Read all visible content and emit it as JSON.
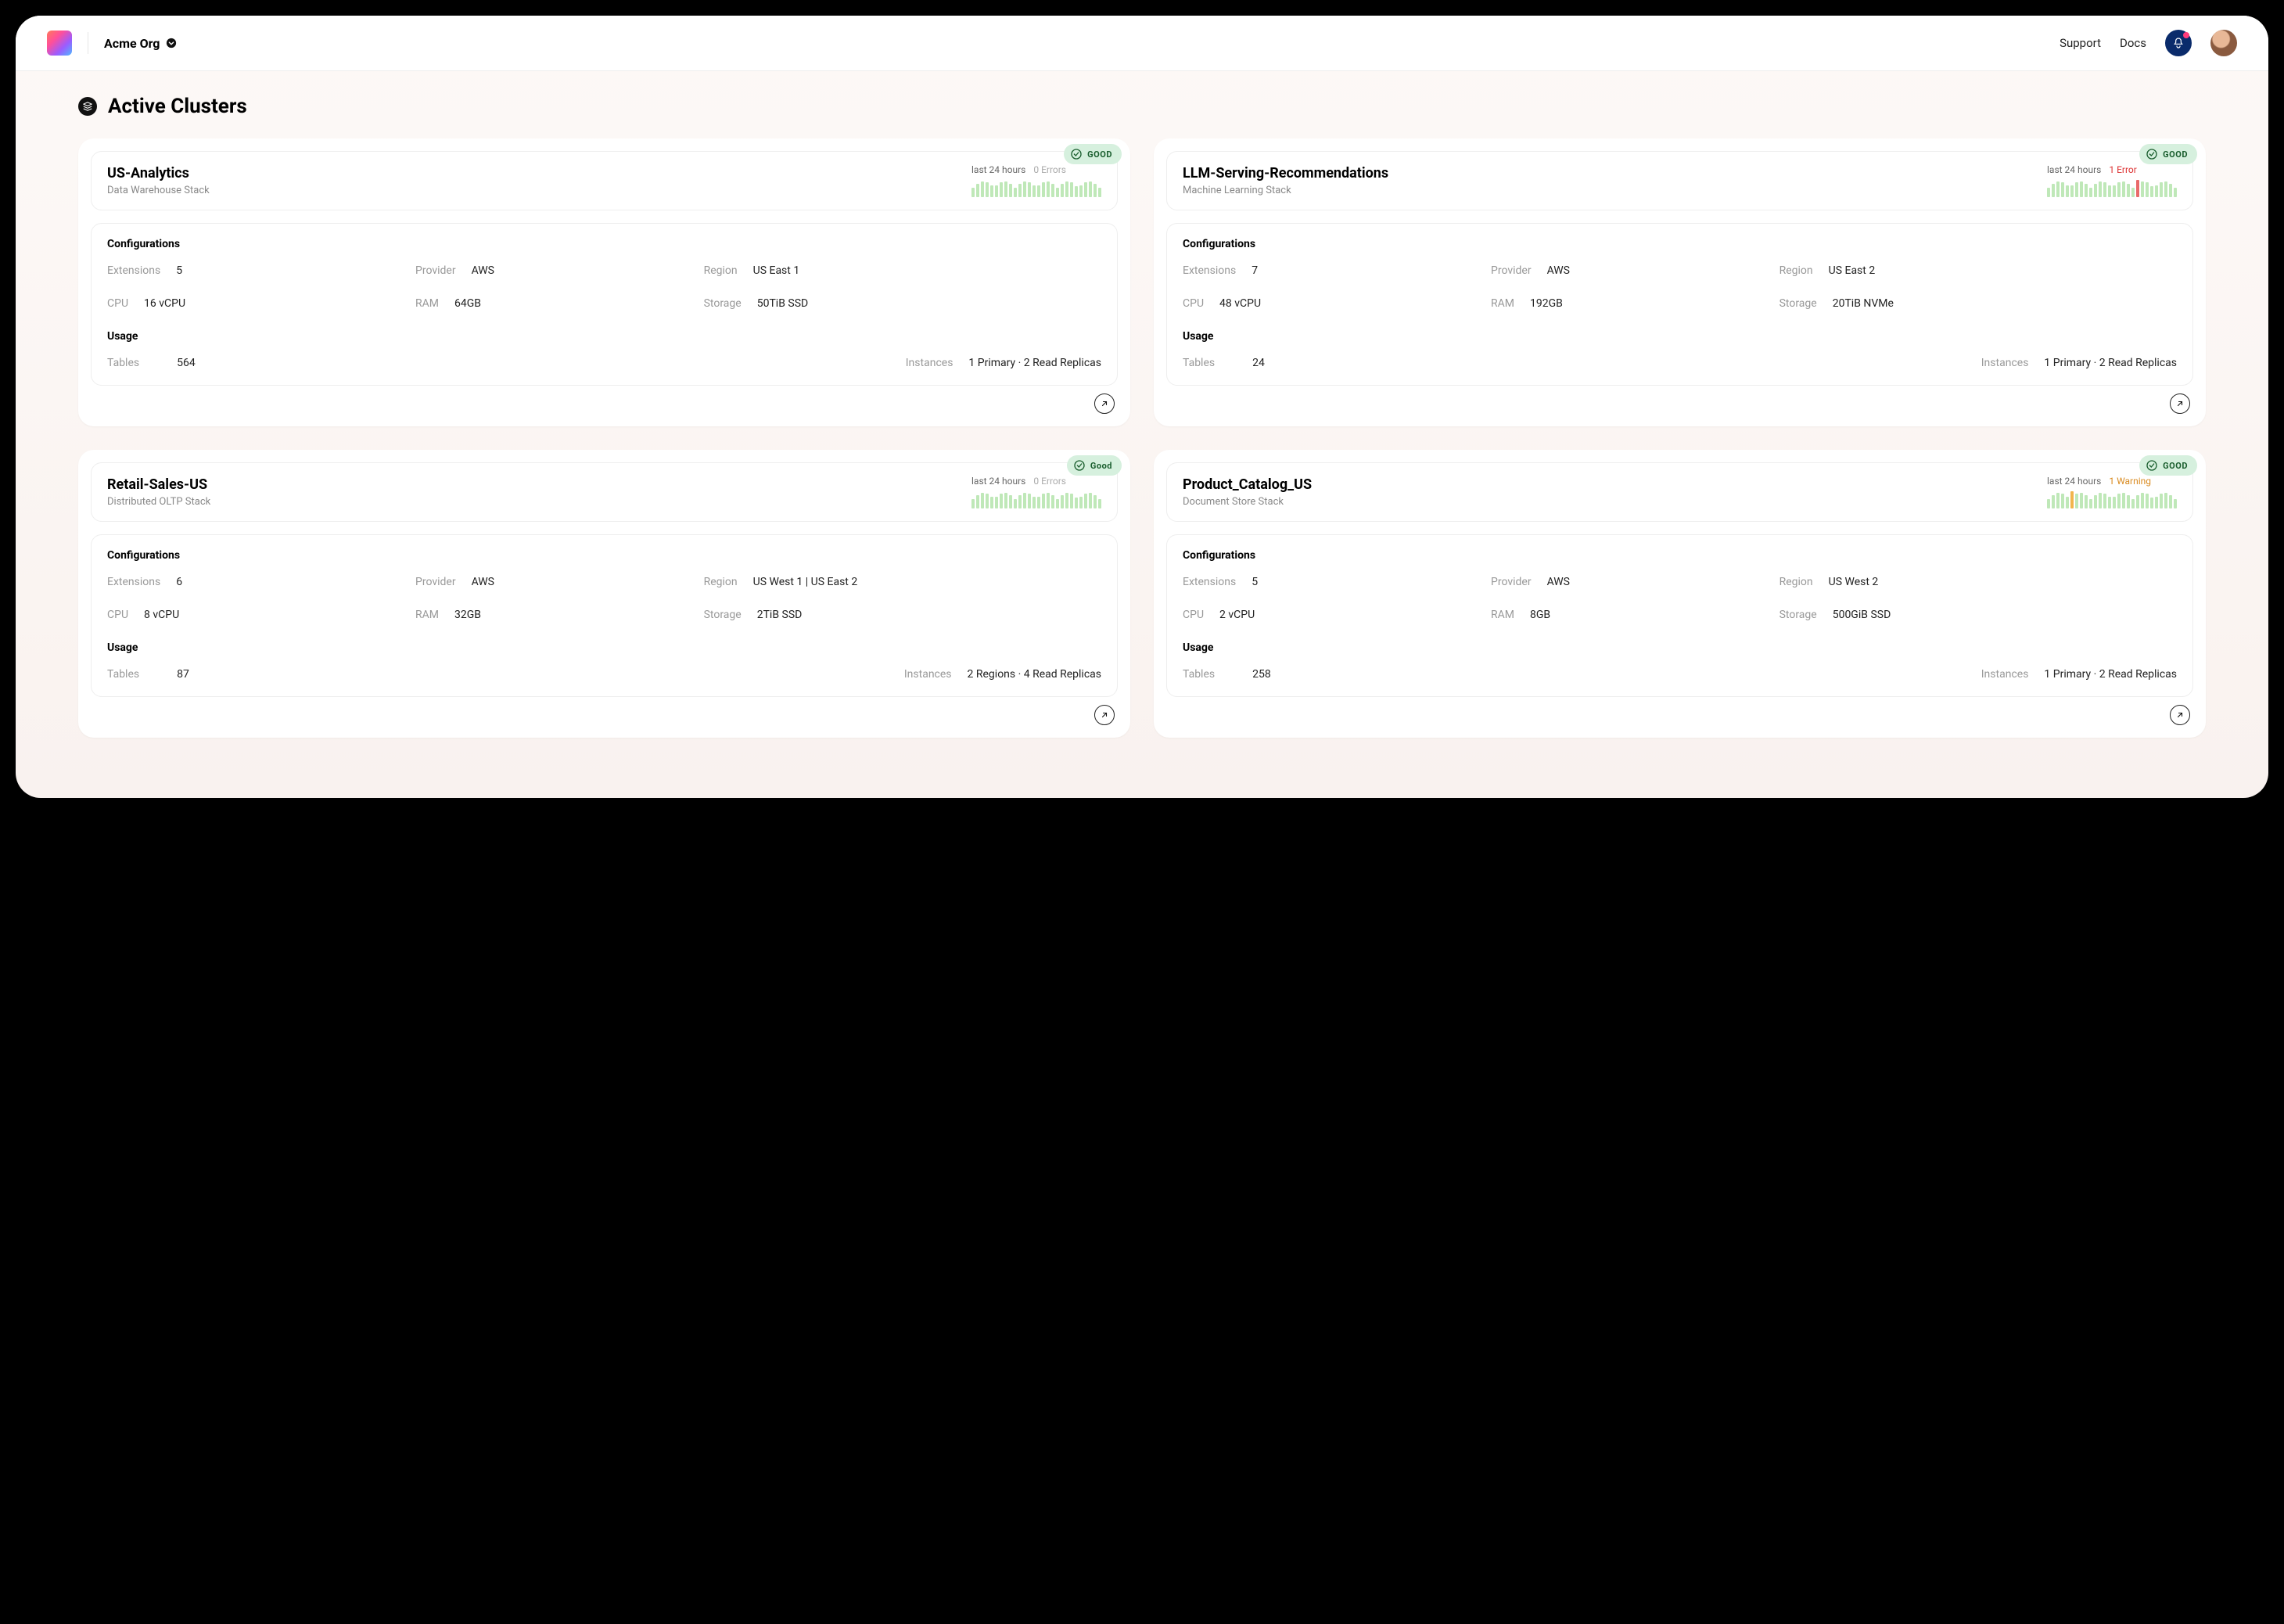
{
  "header": {
    "org_name": "Acme Org",
    "nav": {
      "support": "Support",
      "docs": "Docs"
    }
  },
  "page_title": "Active Clusters",
  "labels": {
    "configurations": "Configurations",
    "usage": "Usage",
    "extensions": "Extensions",
    "provider": "Provider",
    "region": "Region",
    "cpu": "CPU",
    "ram": "RAM",
    "storage": "Storage",
    "tables": "Tables",
    "instances": "Instances",
    "timeframe": "last 24 hours"
  },
  "clusters": [
    {
      "name": "US-Analytics",
      "stack": "Data Warehouse Stack",
      "status": "GOOD",
      "errors_text": "0 Errors",
      "errors_class": "",
      "spark_error_idx": -1,
      "extensions": "5",
      "provider": "AWS",
      "region": "US East 1",
      "cpu": "16 vCPU",
      "ram": "64GB",
      "storage": "50TiB SSD",
      "tables": "564",
      "instances": "1 Primary · 2 Read Replicas"
    },
    {
      "name": "LLM-Serving-Recommendations",
      "stack": "Machine Learning Stack",
      "status": "GOOD",
      "errors_text": "1 Error",
      "errors_class": "err",
      "spark_error_idx": 19,
      "extensions": "7",
      "provider": "AWS",
      "region": "US East 2",
      "cpu": "48 vCPU",
      "ram": "192GB",
      "storage": "20TiB NVMe",
      "tables": "24",
      "instances": "1 Primary · 2 Read Replicas"
    },
    {
      "name": "Retail-Sales-US",
      "stack": "Distributed OLTP Stack",
      "status": "Good",
      "errors_text": "0 Errors",
      "errors_class": "",
      "spark_error_idx": -1,
      "extensions": "6",
      "provider": "AWS",
      "region": "US West 1  |  US East 2",
      "cpu": "8 vCPU",
      "ram": "32GB",
      "storage": "2TiB SSD",
      "tables": "87",
      "instances": "2 Regions · 4 Read Replicas"
    },
    {
      "name": "Product_Catalog_US",
      "stack": "Document Store Stack",
      "status": "GOOD",
      "errors_text": "1 Warning",
      "errors_class": "warn",
      "spark_error_idx": 5,
      "extensions": "5",
      "provider": "AWS",
      "region": "US West 2",
      "cpu": "2 vCPU",
      "ram": "8GB",
      "storage": "500GiB SSD",
      "tables": "258",
      "instances": "1 Primary · 2 Read Replicas"
    }
  ]
}
